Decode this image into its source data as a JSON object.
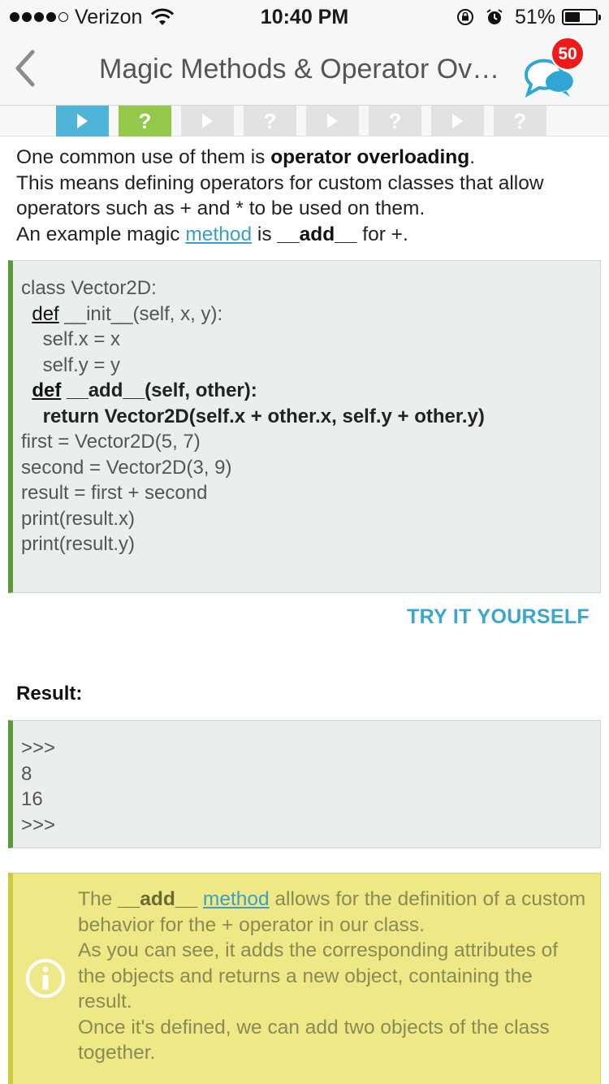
{
  "status_bar": {
    "carrier": "Verizon",
    "time": "10:40 PM",
    "battery_percent": "51%",
    "battery_level": 0.51,
    "signal_bars_filled": 4,
    "signal_bars_total": 5,
    "icons": [
      "wifi-icon",
      "rotation-lock-icon",
      "alarm-icon",
      "battery-icon"
    ]
  },
  "nav": {
    "back_icon": "chevron-left-icon",
    "title": "Magic Methods & Operator Ove...",
    "comments_icon": "comments-bubble-icon",
    "comments_count": "50"
  },
  "progress": {
    "steps": [
      {
        "kind": "lesson",
        "label": "",
        "state": "current"
      },
      {
        "kind": "quiz",
        "label": "?",
        "state": "completed"
      },
      {
        "kind": "lesson",
        "label": "",
        "state": "locked"
      },
      {
        "kind": "quiz",
        "label": "?",
        "state": "locked"
      },
      {
        "kind": "lesson",
        "label": "",
        "state": "locked"
      },
      {
        "kind": "quiz",
        "label": "?",
        "state": "locked"
      },
      {
        "kind": "lesson",
        "label": "",
        "state": "locked"
      },
      {
        "kind": "quiz",
        "label": "?",
        "state": "locked"
      }
    ],
    "colors": {
      "current": "#4fb5d8",
      "completed": "#93c84a",
      "locked": "#e2e2e2"
    }
  },
  "intro": {
    "l1_pre": "One common use of them is ",
    "l1_bold": "operator overloading",
    "l1_post": ".",
    "l2": "This means defining operators for custom classes that allow",
    "l3": "operators such as + and * to be used on them.",
    "l4_pre": "An example magic ",
    "l4_link": "method",
    "l4_mid": " is ",
    "l4_bold": "__add__",
    "l4_post": " for +."
  },
  "code": {
    "lines": [
      "class Vector2D:",
      "  def __init__(self, x, y):",
      "    self.x = x",
      "    self.y = y",
      "  def __add__(self, other):",
      "    return Vector2D(self.x + other.x, self.y + other.y)",
      "",
      "first = Vector2D(5, 7)",
      "second = Vector2D(3, 9)",
      "result = first + second",
      "print(result.x)",
      "print(result.y)"
    ],
    "l1_kw": "def",
    "l1_rest": " __init__(self, x, y):",
    "l4_kw": "def",
    "l4_rest": " __add__(self, other):",
    "accent_color": "#5a9a3a"
  },
  "try_it": {
    "label": "TRY IT YOURSELF"
  },
  "result": {
    "label": "Result:",
    "lines": [
      ">>>",
      "8",
      "16",
      ">>>"
    ]
  },
  "note": {
    "icon": "info-icon",
    "p1_pre": "The ",
    "p1_bold": "__add__",
    "p1_space": " ",
    "p1_link": "method",
    "p1_post": " allows for the definition of a custom behavior for the + operator in our class.",
    "p2": "As you can see, it adds the corresponding attributes of the objects and returns a new object, containing the result.",
    "p3": "Once it's defined, we can add two objects of the class together."
  }
}
